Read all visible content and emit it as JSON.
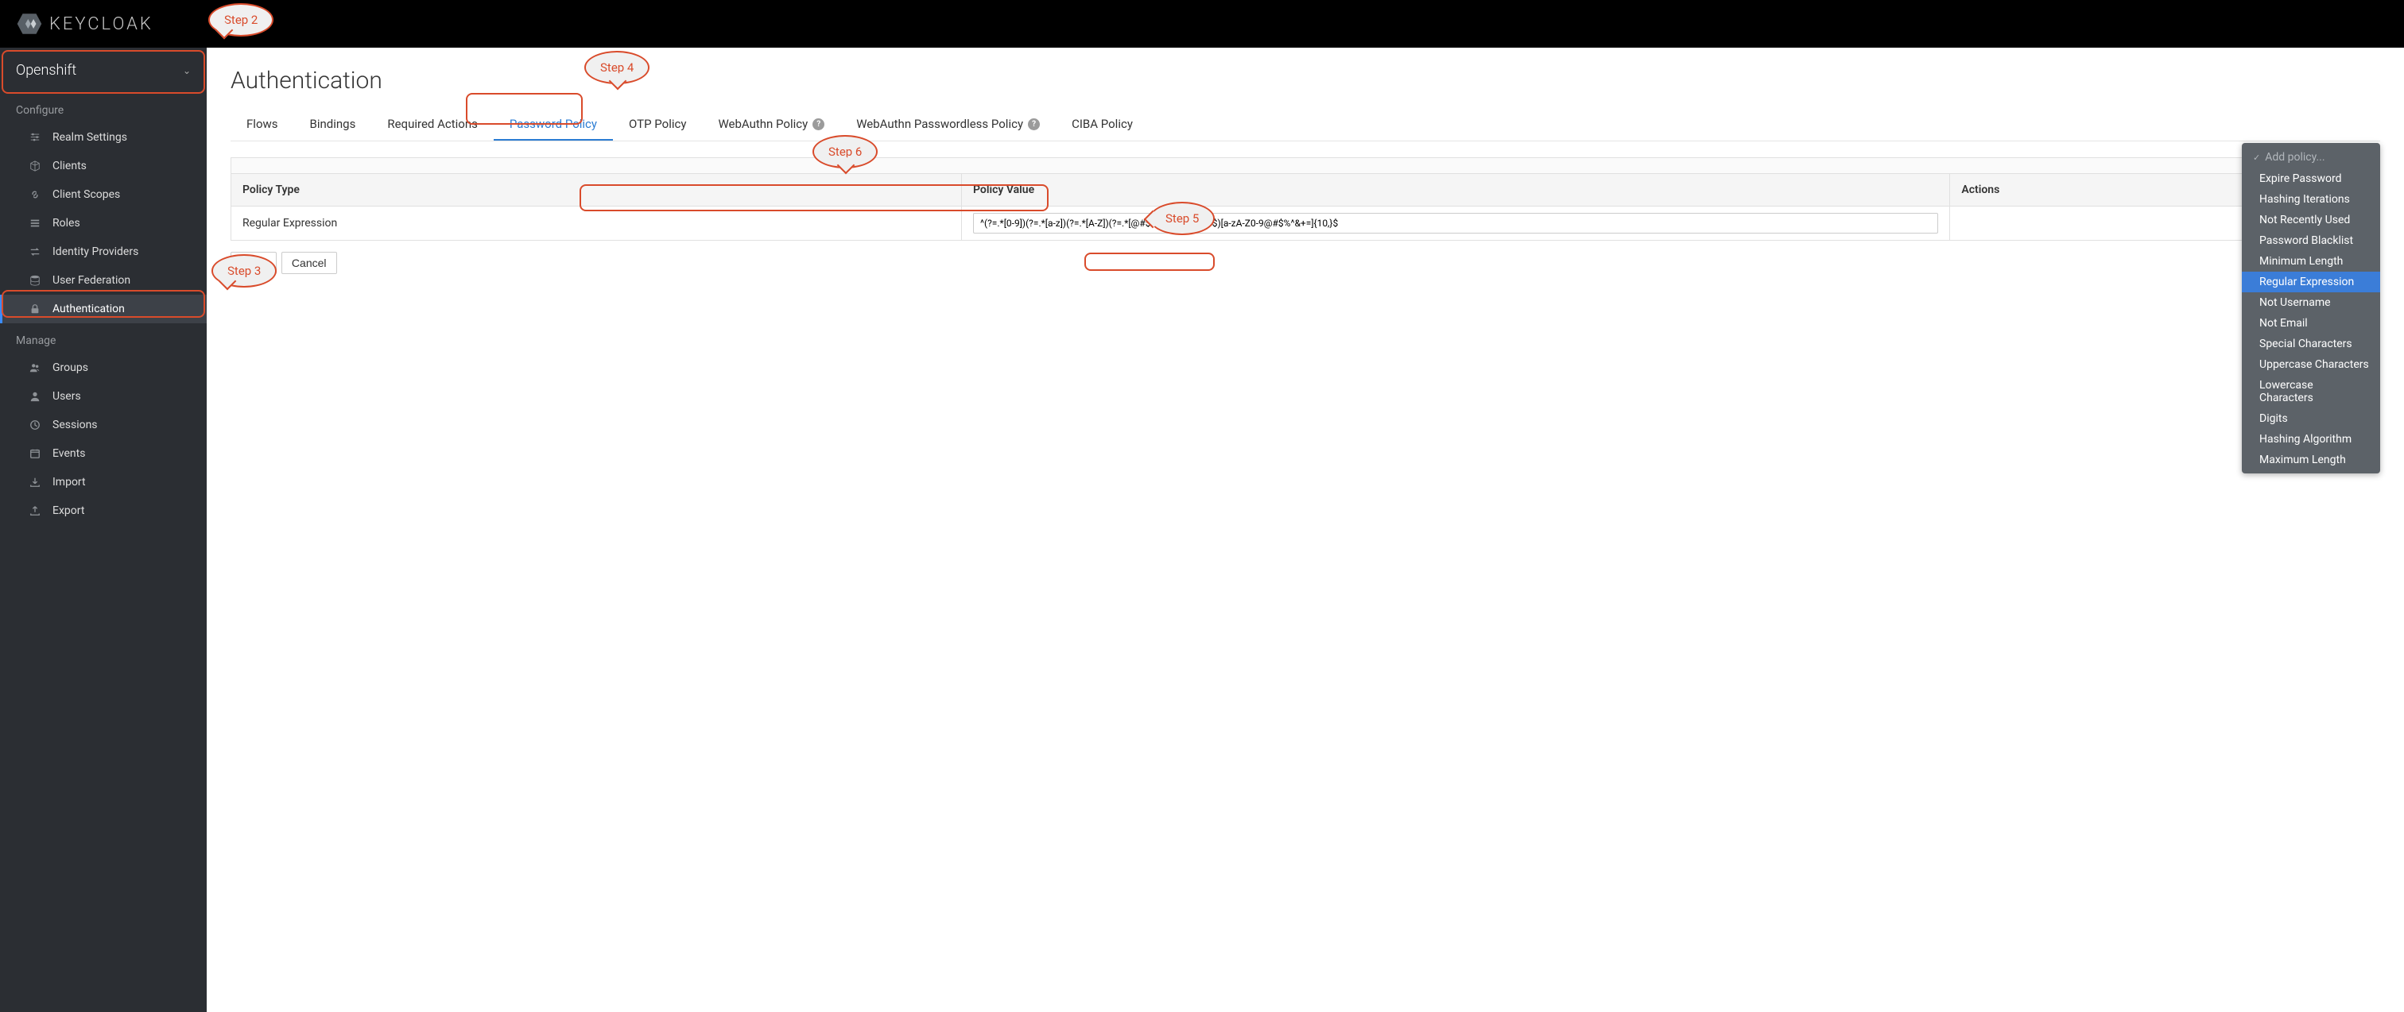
{
  "brand": "KEYCLOAK",
  "realm": "Openshift",
  "sidebar": {
    "sections": [
      {
        "title": "Configure",
        "items": [
          {
            "label": "Realm Settings",
            "icon": "sliders"
          },
          {
            "label": "Clients",
            "icon": "cube"
          },
          {
            "label": "Client Scopes",
            "icon": "link"
          },
          {
            "label": "Roles",
            "icon": "list"
          },
          {
            "label": "Identity Providers",
            "icon": "exchange"
          },
          {
            "label": "User Federation",
            "icon": "database"
          },
          {
            "label": "Authentication",
            "icon": "lock",
            "active": true
          }
        ]
      },
      {
        "title": "Manage",
        "items": [
          {
            "label": "Groups",
            "icon": "users"
          },
          {
            "label": "Users",
            "icon": "user"
          },
          {
            "label": "Sessions",
            "icon": "clock"
          },
          {
            "label": "Events",
            "icon": "calendar"
          },
          {
            "label": "Import",
            "icon": "import"
          },
          {
            "label": "Export",
            "icon": "export"
          }
        ]
      }
    ]
  },
  "page": {
    "title": "Authentication",
    "tabs": [
      {
        "label": "Flows"
      },
      {
        "label": "Bindings"
      },
      {
        "label": "Required Actions"
      },
      {
        "label": "Password Policy",
        "active": true
      },
      {
        "label": "OTP Policy"
      },
      {
        "label": "WebAuthn Policy",
        "help": true
      },
      {
        "label": "WebAuthn Passwordless Policy",
        "help": true
      },
      {
        "label": "CIBA Policy"
      }
    ]
  },
  "table": {
    "headers": {
      "type": "Policy Type",
      "value": "Policy Value",
      "actions": "Actions"
    },
    "rows": [
      {
        "type": "Regular Expression",
        "value": "^(?=.*[0-9])(?=.*[a-z])(?=.*[A-Z])(?=.*[@#$%^&+=])(?=\\S+$)[a-zA-Z0-9@#$%^&+=]{10,}$"
      }
    ]
  },
  "buttons": {
    "save": "Save",
    "cancel": "Cancel"
  },
  "dropdown": {
    "header": "Add policy...",
    "items": [
      {
        "label": "Expire Password"
      },
      {
        "label": "Hashing Iterations"
      },
      {
        "label": "Not Recently Used"
      },
      {
        "label": "Password Blacklist"
      },
      {
        "label": "Minimum Length"
      },
      {
        "label": "Regular Expression",
        "selected": true
      },
      {
        "label": "Not Username"
      },
      {
        "label": "Not Email"
      },
      {
        "label": "Special Characters"
      },
      {
        "label": "Uppercase Characters"
      },
      {
        "label": "Lowercase Characters"
      },
      {
        "label": "Digits"
      },
      {
        "label": "Hashing Algorithm"
      },
      {
        "label": "Maximum Length"
      }
    ]
  },
  "annotations": {
    "step2": "Step 2",
    "step3": "Step 3",
    "step4": "Step 4",
    "step5": "Step 5",
    "step6": "Step 6"
  }
}
